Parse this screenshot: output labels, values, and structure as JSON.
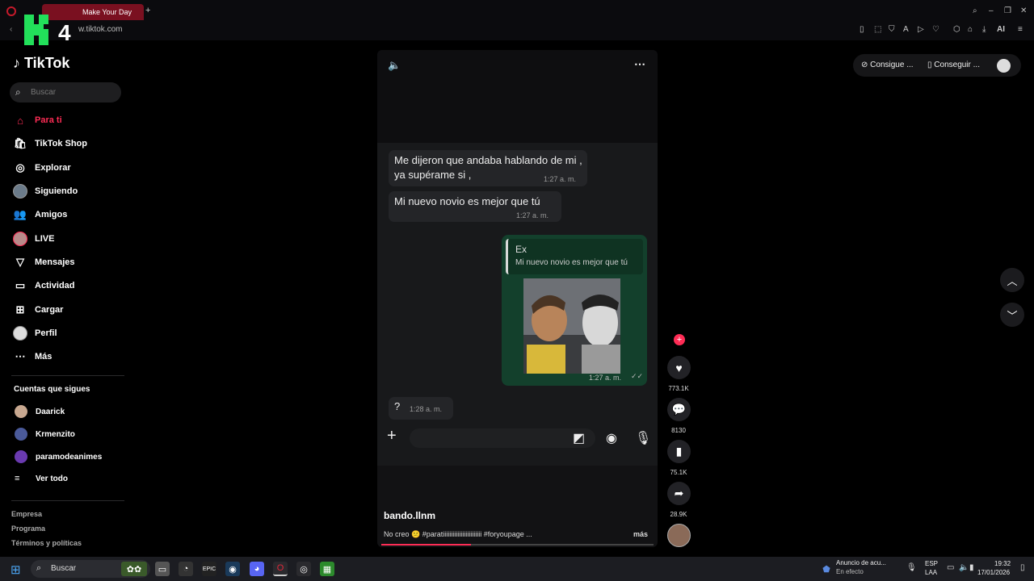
{
  "browser": {
    "tab_title": "Make Your Day",
    "new_tab": "+",
    "url": "w.tiktok.com",
    "watermark": "4"
  },
  "sidebar": {
    "logo": "TikTok",
    "search_placeholder": "Buscar",
    "items": [
      {
        "label": "Para ti",
        "icon": "home-icon",
        "active": true
      },
      {
        "label": "TikTok Shop",
        "icon": "shop-icon"
      },
      {
        "label": "Explorar",
        "icon": "compass-icon"
      },
      {
        "label": "Siguiendo",
        "icon": "avatar-icon"
      },
      {
        "label": "Amigos",
        "icon": "friends-icon"
      },
      {
        "label": "LIVE",
        "icon": "live-avatar-icon"
      },
      {
        "label": "Mensajes",
        "icon": "send-icon"
      },
      {
        "label": "Actividad",
        "icon": "activity-icon"
      },
      {
        "label": "Cargar",
        "icon": "upload-icon"
      },
      {
        "label": "Perfil",
        "icon": "profile-avatar-icon"
      },
      {
        "label": "Más",
        "icon": "more-icon"
      }
    ],
    "following_title": "Cuentas que sigues",
    "following": [
      "Daarick",
      "Krmenzito",
      "paramodeanimes"
    ],
    "see_all": "Ver todo",
    "footer": [
      "Empresa",
      "Programa",
      "Términos y políticas"
    ]
  },
  "top_buttons": {
    "coins": "Consigue ...",
    "app": "Conseguir ..."
  },
  "video": {
    "messages_in": [
      {
        "text": "Me dijeron que andaba hablando de mi , ya supérame si ,",
        "time": "1:27 a. m."
      },
      {
        "text": "Mi nuevo novio es mejor que tú",
        "time": "1:27 a. m."
      }
    ],
    "reply": {
      "quoted_name": "Ex",
      "quoted_text": "Mi nuevo novio es mejor que tú",
      "time": "1:27 a. m."
    },
    "last_message": {
      "text": "?",
      "time": "1:28 a. m."
    },
    "author": "bando.llnm",
    "caption": "No creo 😕 #paratiiiiiiiiiiiiiiiiiiiiiiii #foryoupage ...",
    "more": "más",
    "progress": 0.33
  },
  "actions": {
    "likes": "773.1K",
    "comments": "8130",
    "saves": "75.1K",
    "shares": "28.9K"
  },
  "taskbar": {
    "search": "Buscar",
    "notification_title": "Anuncio de acu...",
    "notification_sub": "En efecto",
    "lang1": "ESP",
    "lang2": "LAA",
    "time": "19:32",
    "date": "17/01/2026"
  },
  "colors": {
    "accent": "#fe2c55",
    "bubble_out": "#13402c"
  }
}
